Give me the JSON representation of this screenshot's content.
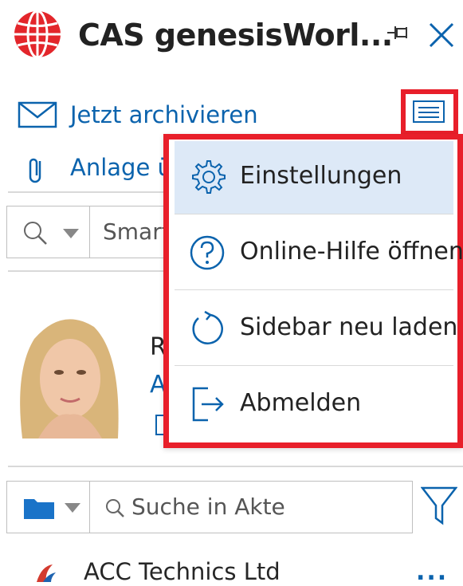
{
  "header": {
    "title": "CAS genesisWorl...",
    "logo": "cas-globe-logo",
    "pin_icon": "pin-icon",
    "close_icon": "close-icon"
  },
  "actions": {
    "archive_label": "Jetzt archivieren",
    "attachment_label": "Anlage ü"
  },
  "search": {
    "placeholder": "Smart"
  },
  "contact": {
    "name_initial": "R",
    "line2": "A"
  },
  "menu": {
    "items": [
      {
        "label": "Einstellungen",
        "icon": "gear-icon",
        "active": true
      },
      {
        "label": "Online-Hilfe öffnen",
        "icon": "help-icon",
        "active": false
      },
      {
        "label": "Sidebar neu laden",
        "icon": "refresh-icon",
        "active": false
      },
      {
        "label": "Abmelden",
        "icon": "logout-icon",
        "active": false
      }
    ]
  },
  "file_search": {
    "placeholder": "Suche in Akte"
  },
  "list": {
    "first_item": "ACC Technics Ltd",
    "more": "..."
  },
  "colors": {
    "accent": "#0b63ad",
    "highlight": "#e81f2a",
    "menu_active": "#dde9f7"
  }
}
